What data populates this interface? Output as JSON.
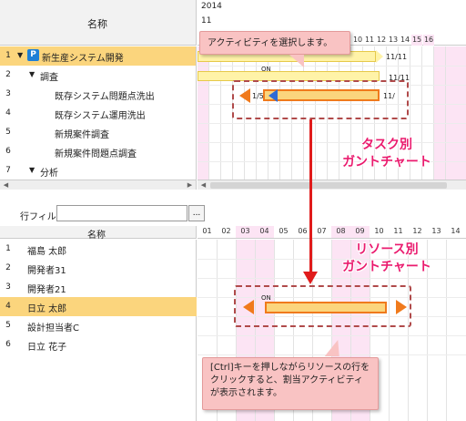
{
  "top": {
    "name_header": "名称",
    "year": "2014",
    "month": "11",
    "days": [
      "10",
      "11",
      "12",
      "13",
      "14",
      "15",
      "16"
    ],
    "rows": [
      {
        "num": "1",
        "label": "新生産システム開発",
        "icon": "P"
      },
      {
        "num": "2",
        "label": "調査"
      },
      {
        "num": "3",
        "label": "既存システム問題点洗出"
      },
      {
        "num": "4",
        "label": "既存システム運用洗出"
      },
      {
        "num": "5",
        "label": "新規案件調査"
      },
      {
        "num": "6",
        "label": "新規案件問題点調査"
      },
      {
        "num": "7",
        "label": "分析"
      }
    ],
    "bar_date_1": "11/11",
    "bar_date_2": "11/11",
    "bar_on_label": "ON",
    "bar_start_label": "1/5",
    "bar_end_label": "11/"
  },
  "bottom": {
    "filter_label": "行フィルタ",
    "filter_value": "",
    "filter_button": "...",
    "name_header": "名称",
    "days": [
      "01",
      "02",
      "03",
      "04",
      "05",
      "06",
      "07",
      "08",
      "09",
      "10",
      "11",
      "12",
      "13",
      "14"
    ],
    "rows": [
      {
        "num": "1",
        "label": "福島 太郎"
      },
      {
        "num": "2",
        "label": "開発者31"
      },
      {
        "num": "3",
        "label": "開発者21"
      },
      {
        "num": "4",
        "label": "日立 太郎"
      },
      {
        "num": "5",
        "label": "設計担当者C"
      },
      {
        "num": "6",
        "label": "日立 花子"
      }
    ],
    "bar_on_label": "ON"
  },
  "callouts": {
    "select_activity": "アクティビティを選択します。",
    "task_gantt_line1": "タスク別",
    "task_gantt_line2": "ガントチャート",
    "resource_gantt_line1": "リソース別",
    "resource_gantt_line2": "ガントチャート",
    "ctrl_tip": "[Ctrl]キーを押しながらリソースの行をクリックすると、割当アクティビティが表示されます。"
  },
  "colors": {
    "selected_row": "#fbd57d",
    "weekend": "#fce4f4",
    "callout_bg": "#f9c3c3",
    "accent": "#ea1b6e",
    "bar_fill": "#fbd57d",
    "bar_border": "#f07a1c",
    "arrow_red": "#e01b1b"
  }
}
